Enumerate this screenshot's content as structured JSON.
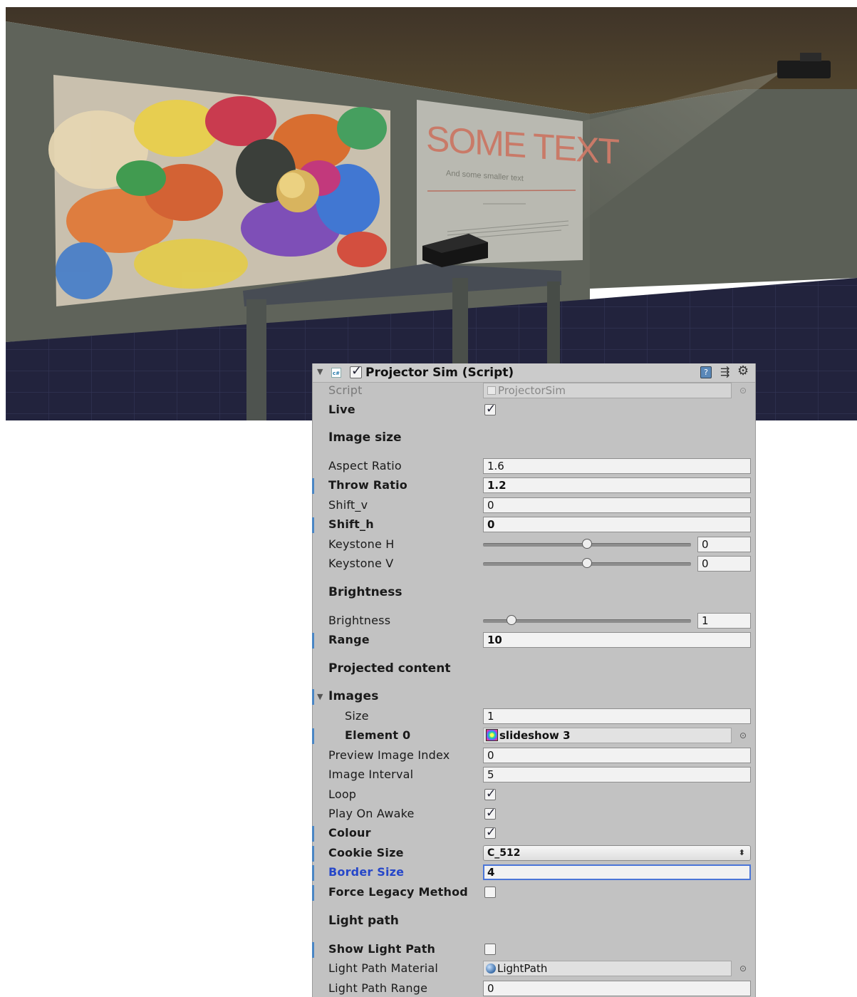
{
  "scene": {
    "slide_title": "SOME TEXT",
    "slide_subtitle": "And some smaller text"
  },
  "component": {
    "title": "Projector Sim (Script)",
    "enabled": true
  },
  "fields": {
    "script_label": "Script",
    "script_value": "ProjectorSim",
    "live_label": "Live",
    "live_checked": true,
    "section_image_size": "Image size",
    "aspect_label": "Aspect Ratio",
    "aspect_value": "1.6",
    "throw_label": "Throw Ratio",
    "throw_value": "1.2",
    "shiftv_label": "Shift_v",
    "shiftv_value": "0",
    "shifth_label": "Shift_h",
    "shifth_value": "0",
    "keyh_label": "Keystone H",
    "keyh_value": "0",
    "keyv_label": "Keystone V",
    "keyv_value": "0",
    "section_brightness": "Brightness",
    "brightness_label": "Brightness",
    "brightness_value": "1",
    "range_label": "Range",
    "range_value": "10",
    "section_projected": "Projected content",
    "images_label": "Images",
    "size_label": "Size",
    "size_value": "1",
    "element0_label": "Element 0",
    "element0_value": "slideshow 3",
    "preview_label": "Preview Image Index",
    "preview_value": "0",
    "interval_label": "Image Interval",
    "interval_value": "5",
    "loop_label": "Loop",
    "loop_checked": true,
    "playawake_label": "Play On Awake",
    "playawake_checked": true,
    "colour_label": "Colour",
    "colour_checked": true,
    "cookie_label": "Cookie Size",
    "cookie_value": "C_512",
    "border_label": "Border Size",
    "border_value": "4",
    "legacy_label": "Force Legacy Method",
    "legacy_checked": false,
    "section_light_path": "Light path",
    "showlight_label": "Show Light Path",
    "showlight_checked": false,
    "lpmat_label": "Light Path Material",
    "lpmat_value": "LightPath",
    "lprange_label": "Light Path Range",
    "lprange_value": "0"
  },
  "icons": {
    "collapse": "triangle-down-icon",
    "script": "csharp-script-icon",
    "help": "help-book-icon",
    "preset": "preset-sliders-icon",
    "settings": "gear-icon",
    "picker": "object-picker-icon",
    "texture": "texture-icon",
    "material": "material-sphere-icon"
  },
  "colors": {
    "inspector_bg": "#c2c2c2",
    "modified_bar": "#4a86c4",
    "focus_label": "#2647c9"
  }
}
